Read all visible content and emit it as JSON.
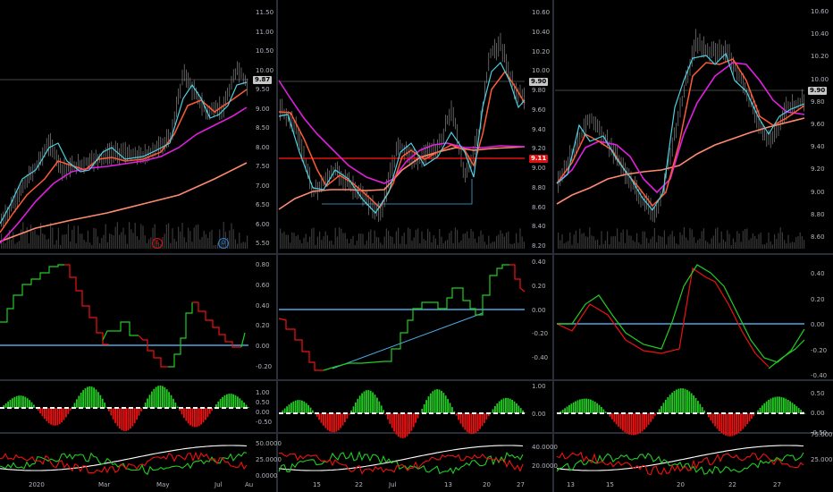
{
  "colors": {
    "background": "#000000",
    "candle": "#9a9a9a",
    "ema_fast": "#4dd0e1",
    "ema_mid": "#ff5a36",
    "ema_slow": "#e020e0",
    "ema_long": "#ff8a70",
    "zero_line": "#4aa8e0",
    "osc_up": "#22cc22",
    "osc_down": "#ee1111",
    "white_line": "#ffffff",
    "tag_bg": "#c8c8c8",
    "tag_red": "#e01010"
  },
  "panes": [
    {
      "name": "left",
      "price_axis": [
        "11.50",
        "11.00",
        "10.50",
        "10.00",
        "9.50",
        "9.00",
        "8.50",
        "8.00",
        "7.50",
        "7.00",
        "6.50",
        "6.00",
        "5.50"
      ],
      "price_tag": "9.87",
      "osc_axis": [
        "0.80",
        "0.60",
        "0.40",
        "0.20",
        "0.00",
        "-0.20"
      ],
      "hist_axis": [
        "1.00",
        "0.50",
        "0.00",
        "-0.50"
      ],
      "rsi_axis": [
        "50.0000",
        "25.0000",
        "0.0000"
      ],
      "x_labels": [
        "2020",
        "Mar",
        "May",
        "Jul",
        "Au"
      ],
      "markers": [
        "E",
        "D"
      ]
    },
    {
      "name": "middle",
      "price_axis": [
        "10.60",
        "10.40",
        "10.20",
        "10.00",
        "9.80",
        "9.60",
        "9.40",
        "9.20",
        "9.00",
        "8.80",
        "8.60",
        "8.40",
        "8.20"
      ],
      "price_tag": "9.90",
      "price_tag_red": "9.11",
      "osc_axis": [
        "0.40",
        "0.20",
        "0.00",
        "-0.20",
        "-0.40"
      ],
      "hist_axis": [
        "1.00",
        "0.00"
      ],
      "rsi_axis": [
        "40.0000",
        "20.0000"
      ],
      "x_labels": [
        "15",
        "22",
        "Jul",
        "13",
        "20",
        "27"
      ],
      "markers": []
    },
    {
      "name": "right",
      "price_axis": [
        "10.60",
        "10.40",
        "10.20",
        "10.00",
        "9.80",
        "9.60",
        "9.40",
        "9.20",
        "9.00",
        "8.80",
        "8.60"
      ],
      "price_tag": "9.90",
      "osc_axis": [
        "0.40",
        "0.20",
        "0.00",
        "-0.20",
        "-0.40"
      ],
      "hist_axis": [
        "0.50",
        "0.00",
        "-0.50"
      ],
      "rsi_axis": [
        "75.0000",
        "25.0000"
      ],
      "x_labels": [
        "13",
        "15",
        "20",
        "22",
        "27"
      ],
      "markers": []
    }
  ]
}
